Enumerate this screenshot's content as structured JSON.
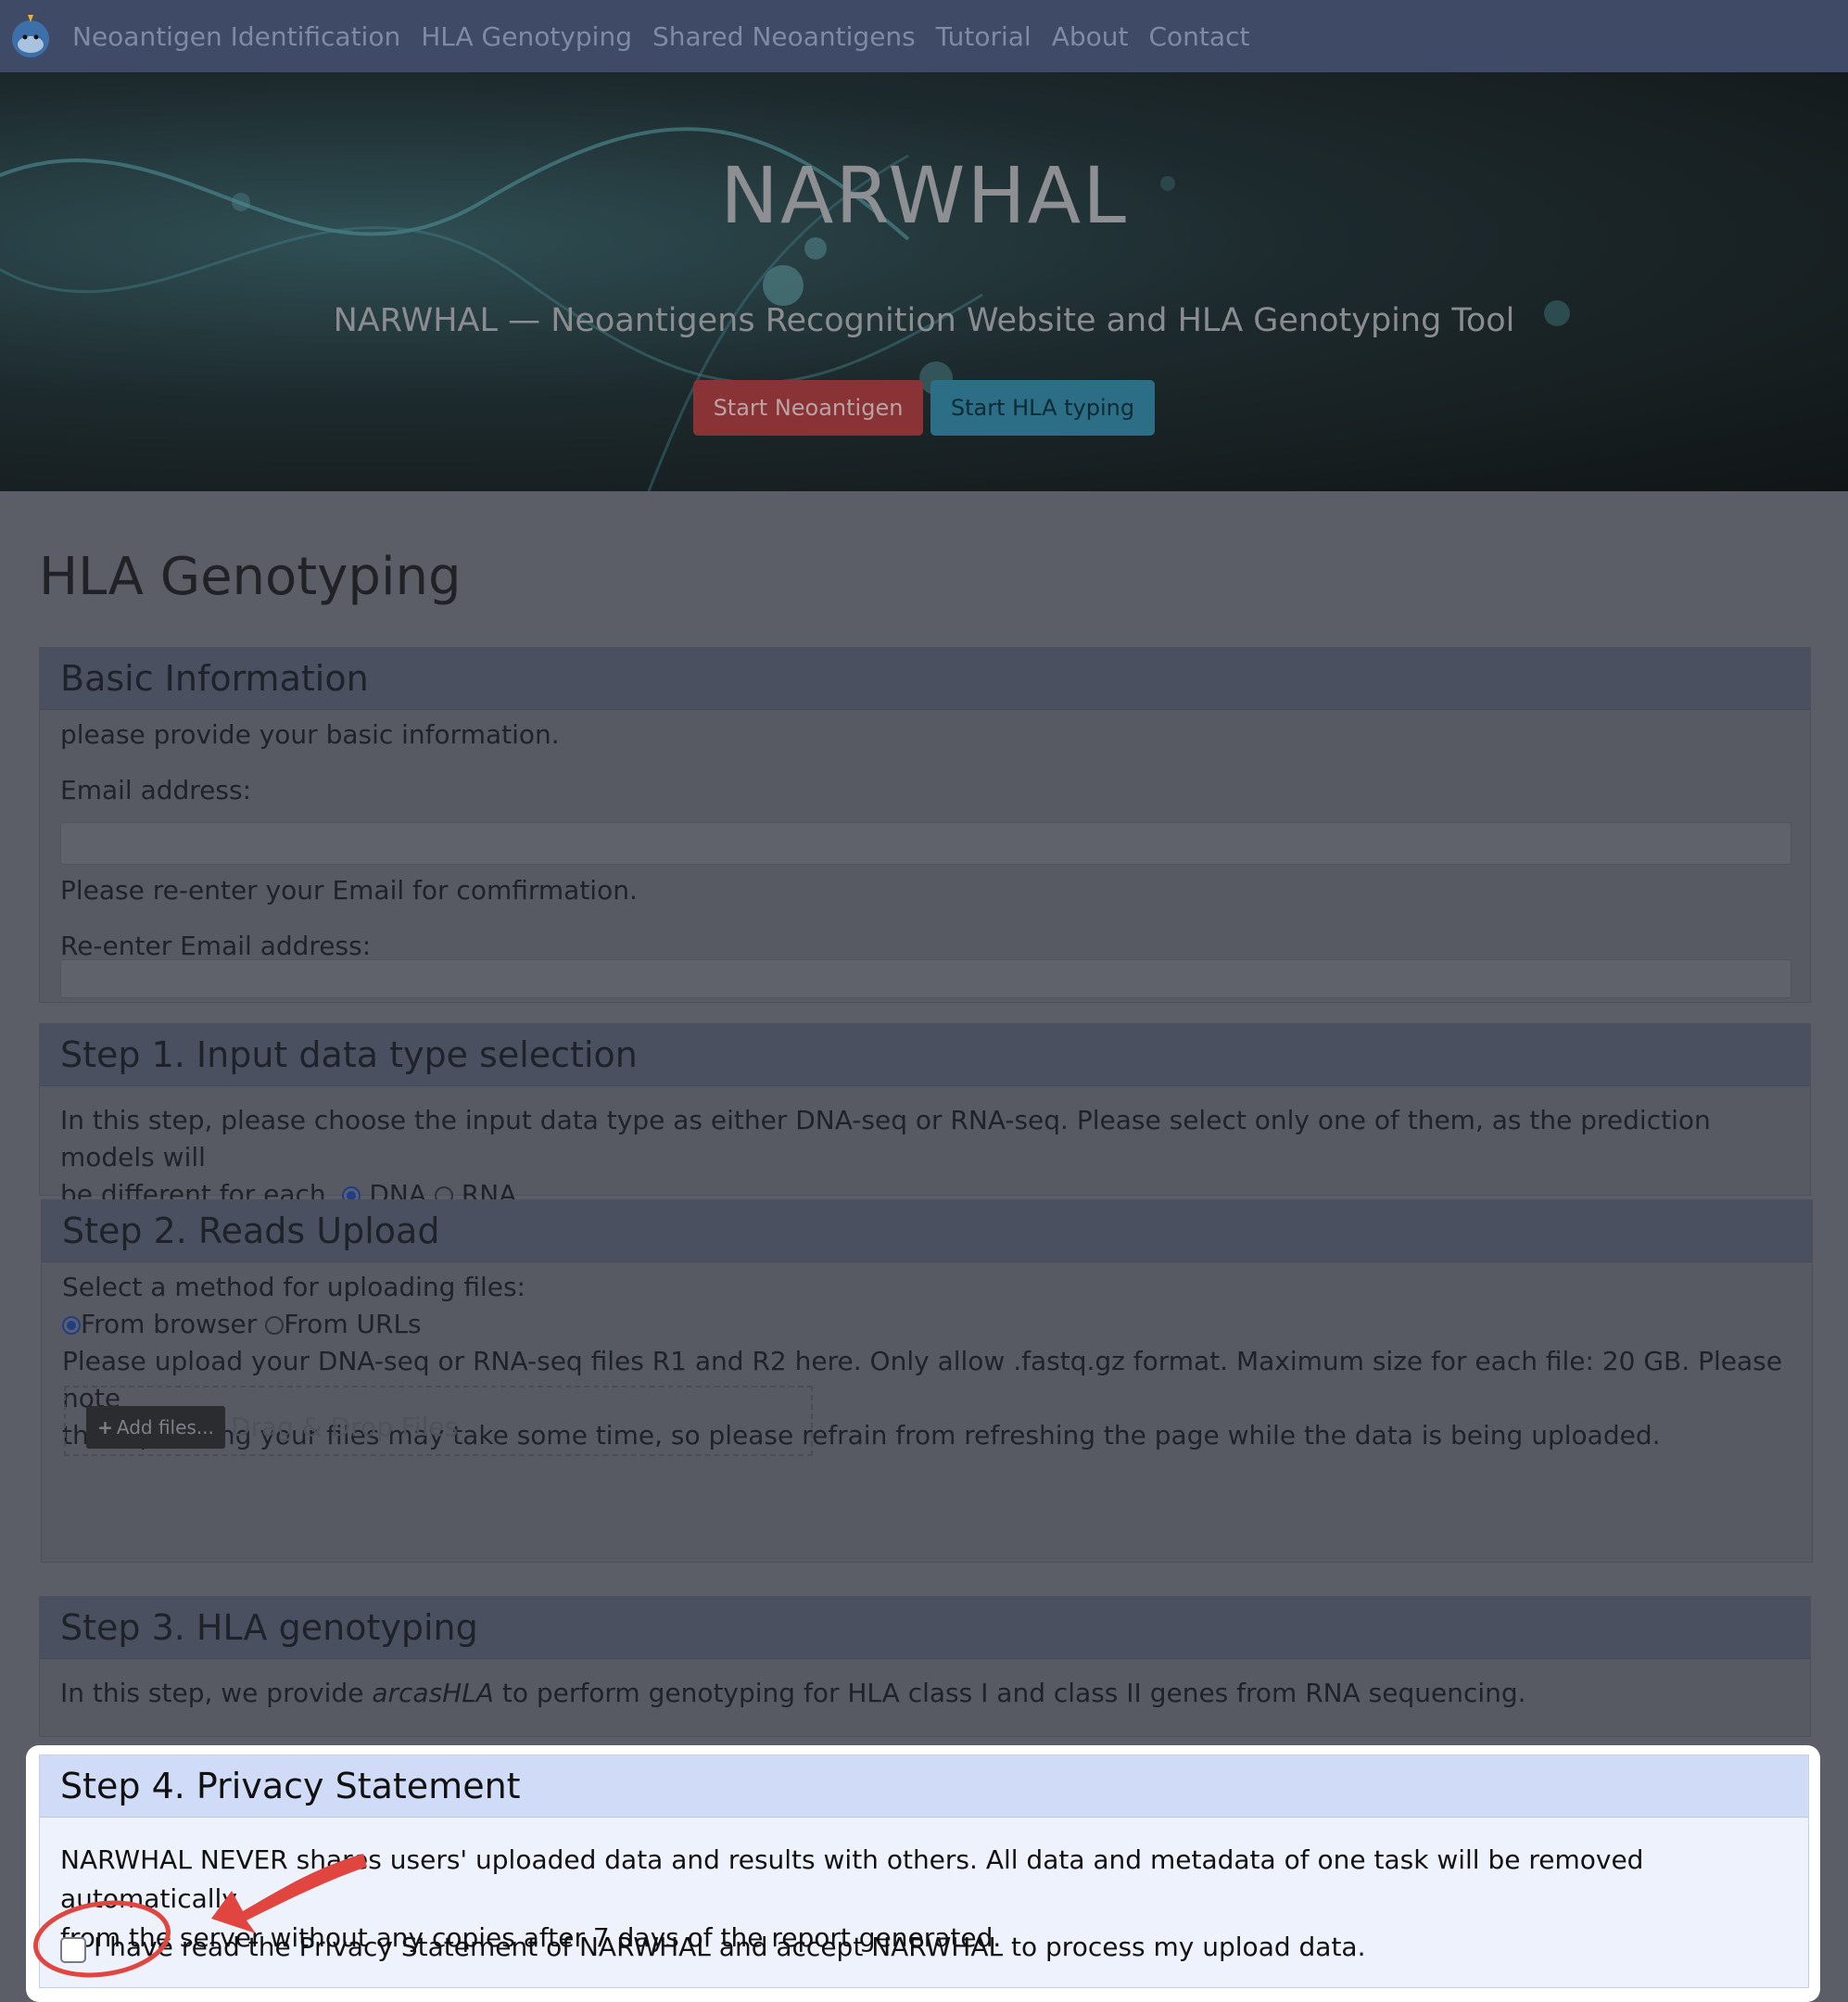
{
  "nav": {
    "items": [
      "Neoantigen Identification",
      "HLA Genotyping",
      "Shared Neoantigens",
      "Tutorial",
      "About",
      "Contact"
    ]
  },
  "hero": {
    "title": "NARWHAL",
    "subtitle": "NARWHAL — Neoantigens Recognition Website and HLA Genotyping Tool",
    "btn_neo": "Start Neoantigen",
    "btn_hla": "Start HLA typing"
  },
  "page": {
    "title": "HLA Genotyping"
  },
  "basic": {
    "header": "Basic Information",
    "intro": "please provide your basic information.",
    "email_label": "Email address:",
    "confirm_text": "Please re-enter your Email for comfirmation.",
    "reenter_label": "Re-enter Email address:"
  },
  "step1": {
    "header": "Step 1. Input data type selection",
    "text_line1": "In this step, please choose the input data type as either DNA-seq or RNA-seq. Please select only one of them, as the prediction models will",
    "text_line2": "be different for each.",
    "opt_dna": "DNA",
    "opt_rna": "RNA",
    "selected": "DNA"
  },
  "step2": {
    "header": "Step 2. Reads Upload",
    "method_label": "Select a method for uploading files:",
    "opt_browser": "From browser",
    "opt_urls": "From URLs",
    "selected": "From browser",
    "note_line1": "Please upload your DNA-seq or RNA-seq files R1 and R2 here. Only allow .fastq.gz format. Maximum size for each file: 20 GB. Please note",
    "note_line2": "that uploading your files may take some time, so please refrain from refreshing the page while the data is being uploaded.",
    "add_files": "Add files...",
    "drop_text": "Drag & Drop Files"
  },
  "step3": {
    "header": "Step 3. HLA genotyping",
    "text_before": "In this step, we provide ",
    "tool": "arcasHLA",
    "text_after": " to perform genotyping for HLA class I and class II genes from RNA sequencing."
  },
  "step4": {
    "header": "Step 4. Privacy Statement",
    "text_line1": "NARWHAL NEVER shares users' uploaded data and results with others. All data and metadata of one task will be removed automatically",
    "text_line2": "from the server without any copies after 7 days of the report generated.",
    "checkbox_label": "I have read the Privacy Statement of NARWHAL and accept NARWHAL to process my upload data.",
    "checked": false
  },
  "colors": {
    "navbar": "#3e4a66",
    "btn_neoantigen": "#8a3336",
    "btn_hla": "#2c6e86",
    "annotation_red": "#e0463f",
    "step4_header": "#cfdbf7"
  }
}
